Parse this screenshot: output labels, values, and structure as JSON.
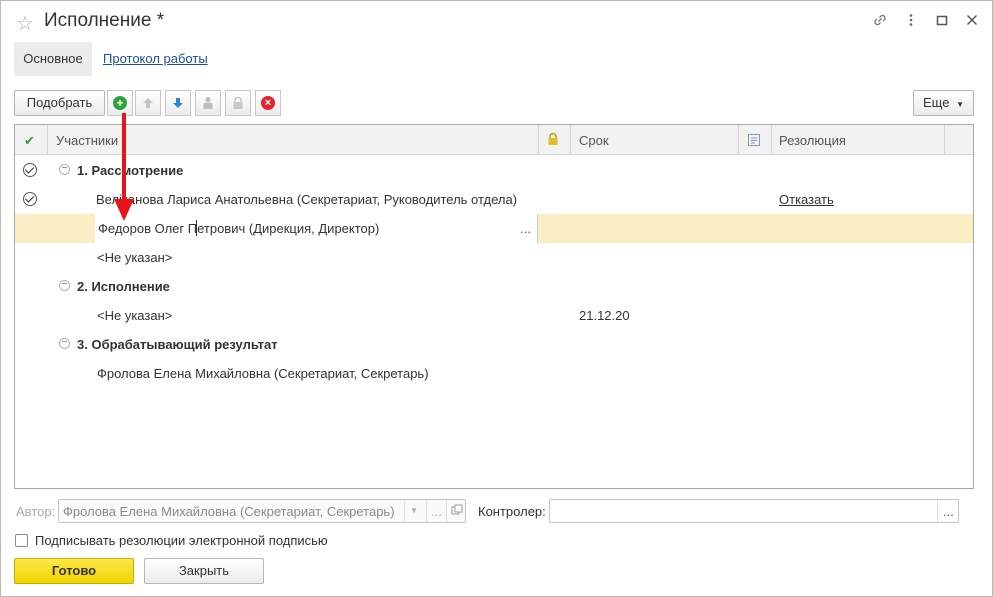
{
  "window": {
    "title": "Исполнение *",
    "controls": [
      "link-icon",
      "more-icon",
      "maximize-icon",
      "close-icon"
    ]
  },
  "tabs": [
    {
      "label": "Основное",
      "active": true
    },
    {
      "label": "Протокол работы",
      "active": false
    }
  ],
  "toolbar": {
    "pick_label": "Подобрать",
    "more_label": "Еще",
    "icons": [
      "add-icon",
      "move-up-icon",
      "move-down-icon",
      "user-icon",
      "lock-icon",
      "delete-icon"
    ]
  },
  "grid": {
    "columns": {
      "check": "✔",
      "participants": "Участники",
      "lock": "",
      "due": "Срок",
      "note": "",
      "resolution": "Резолюция"
    },
    "groups": [
      {
        "label": "1. Рассмотрение",
        "checked": true,
        "rows": [
          {
            "name": "Веліканова Лариса Анатольевна (Секретариат, Руководитель отдела)",
            "checked": true,
            "due": "",
            "resolution": "Отказать"
          },
          {
            "name": "Федоров Олег Петрович (Дирекция, Директор)",
            "checked": false,
            "due": "",
            "resolution": "",
            "selected": true,
            "editing": true
          },
          {
            "name": "<Не указан>",
            "checked": false,
            "due": "",
            "resolution": ""
          }
        ]
      },
      {
        "label": "2. Исполнение",
        "checked": false,
        "rows": [
          {
            "name": "<Не указан>",
            "checked": false,
            "due": "21.12.20",
            "resolution": ""
          }
        ]
      },
      {
        "label": "3. Обрабатывающий результат",
        "checked": false,
        "rows": [
          {
            "name": "Фролова Елена Михайловна (Секретариат, Секретарь)",
            "checked": false,
            "due": "",
            "resolution": ""
          }
        ]
      }
    ],
    "ellipsis": "..."
  },
  "footer": {
    "author_label": "Автор:",
    "author_value": "Фролова Елена Михайловна (Секретариат, Секретарь)",
    "controller_label": "Контролер:",
    "controller_value": "",
    "sign_label": "Подписывать резолюции электронной подписью",
    "sign_checked": false,
    "ok_label": "Готово",
    "close_label": "Закрыть",
    "ellipsis": "..."
  },
  "colors": {
    "accent_yellow": "#f5d800",
    "selection": "#fbeec5",
    "link": "#1c4fa3",
    "arrow": "#e8141b"
  }
}
